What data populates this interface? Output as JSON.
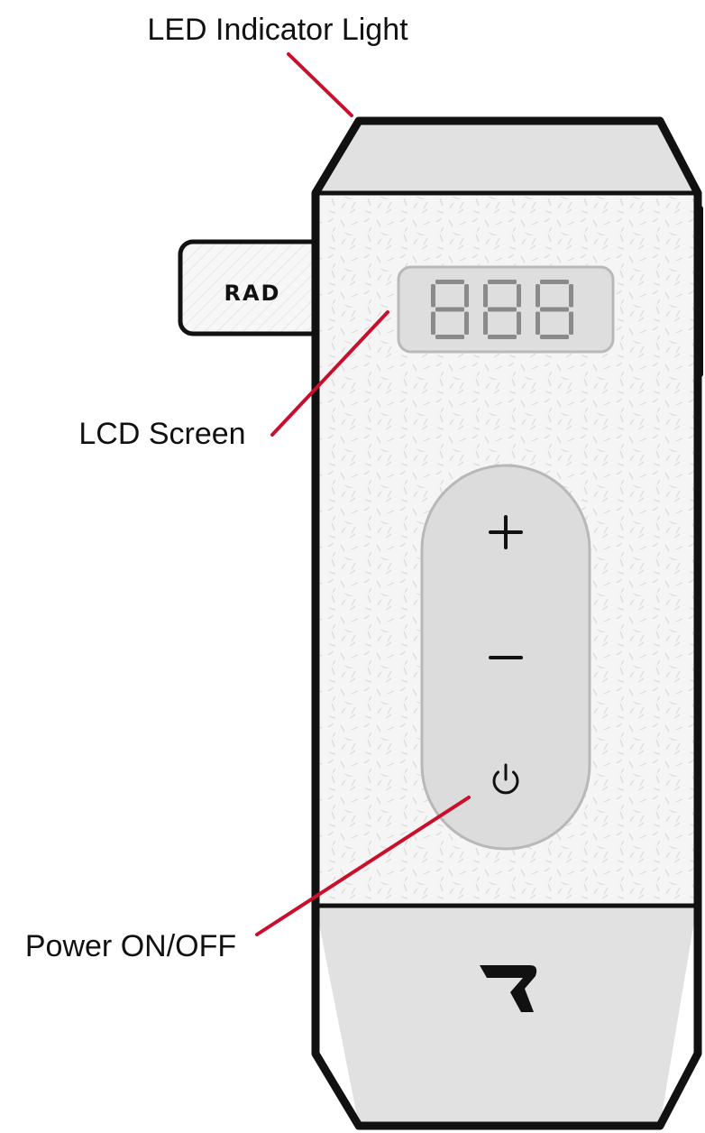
{
  "callouts": {
    "led": "LED Indicator Light",
    "lcd": "LCD Screen",
    "power": "Power ON/OFF"
  },
  "device": {
    "tag_text": "RAD",
    "display_digits": "888"
  },
  "colors": {
    "leader_line": "#c8102e",
    "body_fill": "#f4f4f4",
    "cap_fill": "#e1e1e1",
    "outline": "#111111",
    "panel_fill": "#dcdcdc",
    "segment": "#8a8a8a"
  }
}
